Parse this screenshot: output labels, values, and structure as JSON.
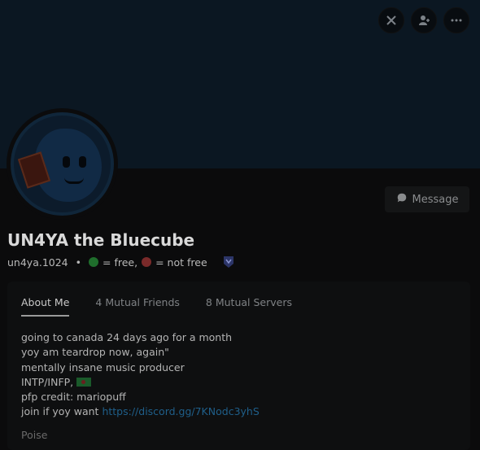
{
  "profile": {
    "display_name": "UN4YA the Bluecube",
    "username": "un4ya.1024",
    "separator": "•",
    "status_free": "= free,",
    "status_not_free": "= not free"
  },
  "actions": {
    "message_label": "Message"
  },
  "tabs": [
    {
      "label": "About Me",
      "active": true
    },
    {
      "label": "4 Mutual Friends",
      "active": false
    },
    {
      "label": "8 Mutual Servers",
      "active": false
    }
  ],
  "bio": {
    "line1": "going to canada 24 days ago for a month",
    "line2": "yoy am teardrop now, again\"",
    "line3": "mentally insane music producer",
    "line4": "INTP/INFP,",
    "line5": "pfp credit: mariopuff",
    "line6_prefix": "join if yoy want",
    "line6_link": "https://discord.gg/7KNodc3yhS",
    "line7": "Poise"
  },
  "colors": {
    "banner": "#0b1722",
    "link": "#1f5f8a",
    "free_dot": "#1f6e2c",
    "not_free_dot": "#7a2a2a"
  },
  "icons": {
    "top_left_button": "no-games-icon",
    "top_middle_button": "add-friend-icon",
    "top_right_button": "more-icon",
    "message_button": "chat-bubble-icon",
    "badge": "hypesquad-badge-icon"
  }
}
